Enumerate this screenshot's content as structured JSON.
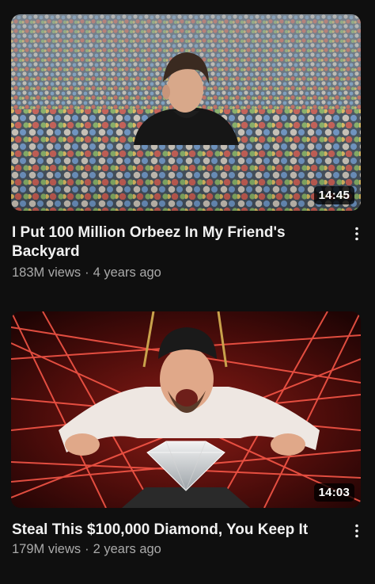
{
  "videos": [
    {
      "title": "I Put 100 Million Orbeez In My Friend's Backyard",
      "views": "183M views",
      "age": "4 years ago",
      "duration": "14:45",
      "thumbnail_icon": "orbeez-thumbnail"
    },
    {
      "title": "Steal This $100,000 Diamond, You Keep It",
      "views": "179M views",
      "age": "2 years ago",
      "duration": "14:03",
      "thumbnail_icon": "laser-diamond-thumbnail"
    }
  ],
  "meta_separator": "·",
  "colors": {
    "background": "#0f0f0f",
    "title": "#f1f1f1",
    "meta": "#aaaaaa"
  }
}
